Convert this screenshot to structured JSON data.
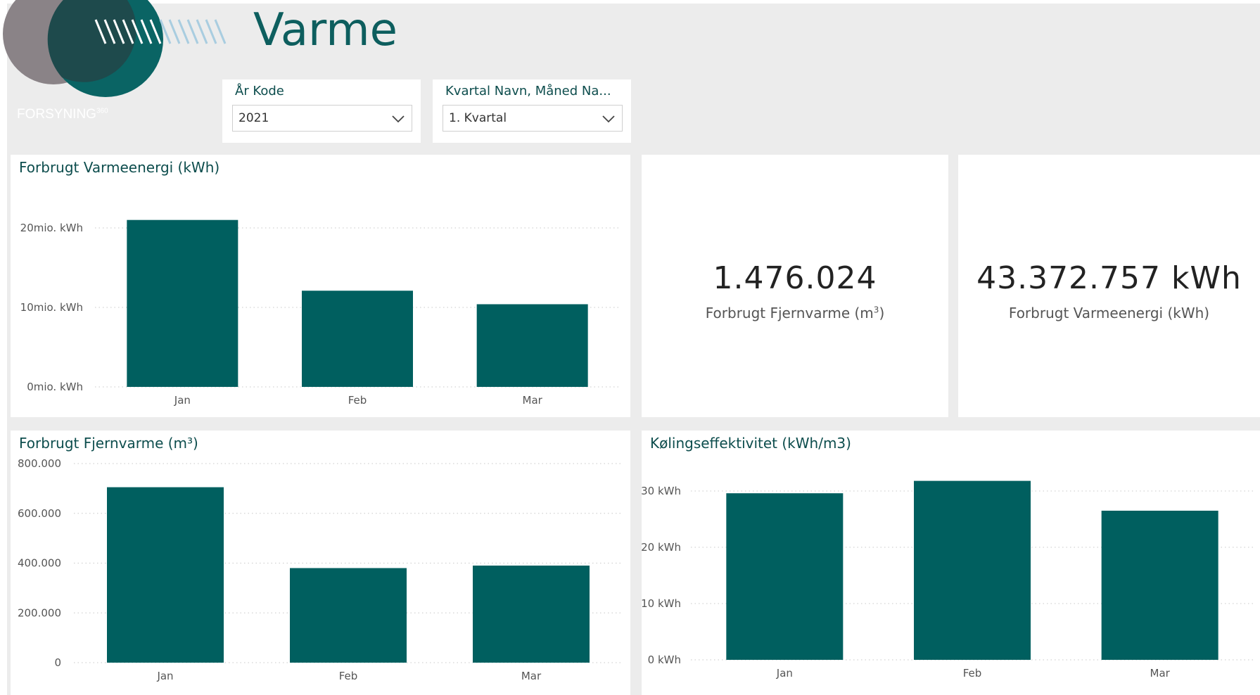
{
  "header": {
    "title": "Varme",
    "logo_text": "FORSYNING",
    "logo_sup": "360"
  },
  "slicers": {
    "year": {
      "label": "År Kode",
      "value": "2021"
    },
    "period": {
      "label": "Kvartal Navn, Måned Na...",
      "value": "1. Kvartal"
    }
  },
  "cards": {
    "fjernvarme": {
      "value": "1.476.024",
      "label_main": "Forbrugt Fjernvarme (m",
      "label_sup": "3",
      "label_end": ")"
    },
    "varmeenergi": {
      "value": "43.372.757 kWh",
      "label": "Forbrugt Varmeenergi (kWh)"
    }
  },
  "colors": {
    "bar": "#005f5f",
    "title": "#0d4d4d",
    "background": "#ececec"
  },
  "chart_data": [
    {
      "id": "varmeenergi",
      "type": "bar",
      "title": "Forbrugt Varmeenergi (kWh)",
      "categories": [
        "Jan",
        "Feb",
        "Mar"
      ],
      "values": [
        21000000,
        12100000,
        10400000
      ],
      "ylim": [
        0,
        20000000
      ],
      "yticks": [
        {
          "value": 0,
          "label": "0mio. kWh"
        },
        {
          "value": 10000000,
          "label": "10mio. kWh"
        },
        {
          "value": 20000000,
          "label": "20mio. kWh"
        }
      ],
      "grid": true
    },
    {
      "id": "fjernvarme",
      "type": "bar",
      "title": "Forbrugt Fjernvarme (m³)",
      "categories": [
        "Jan",
        "Feb",
        "Mar"
      ],
      "values": [
        705000,
        380000,
        390000
      ],
      "ylim": [
        0,
        800000
      ],
      "yticks": [
        {
          "value": 0,
          "label": "0"
        },
        {
          "value": 200000,
          "label": "200.000"
        },
        {
          "value": 400000,
          "label": "400.000"
        },
        {
          "value": 600000,
          "label": "600.000"
        },
        {
          "value": 800000,
          "label": "800.000"
        }
      ],
      "grid": true
    },
    {
      "id": "koeling",
      "type": "bar",
      "title": "Kølingseffektivitet (kWh/m3)",
      "categories": [
        "Jan",
        "Feb",
        "Mar"
      ],
      "values": [
        29.6,
        31.8,
        26.5
      ],
      "ylim": [
        0,
        30
      ],
      "yticks": [
        {
          "value": 0,
          "label": "0 kWh"
        },
        {
          "value": 10,
          "label": "10 kWh"
        },
        {
          "value": 20,
          "label": "20 kWh"
        },
        {
          "value": 30,
          "label": "30 kWh"
        }
      ],
      "grid": true
    }
  ]
}
